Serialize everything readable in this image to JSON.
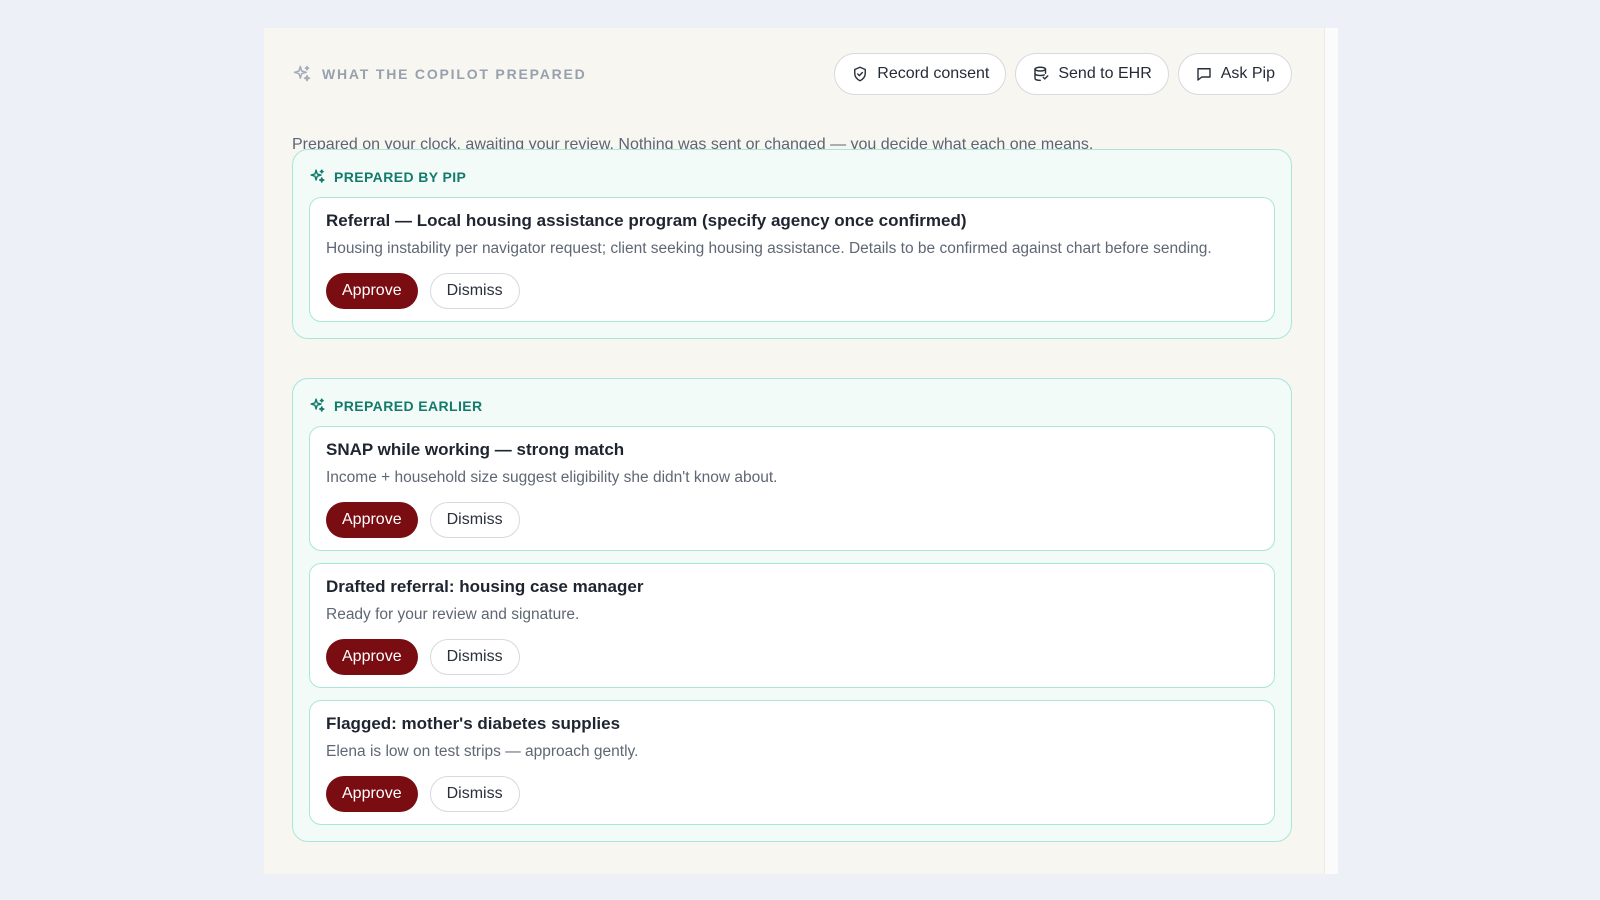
{
  "header": {
    "title": "WHAT THE COPILOT PREPARED",
    "actions": {
      "record_consent": "Record consent",
      "send_to_ehr": "Send to EHR",
      "ask_pip": "Ask Pip"
    }
  },
  "subtitle": "Prepared on your clock, awaiting your review. Nothing was sent or changed — you decide what each one means.",
  "sections": [
    {
      "label": "PREPARED BY PIP",
      "cards": [
        {
          "title": "Referral — Local housing assistance program (specify agency once confirmed)",
          "desc": "Housing instability per navigator request; client seeking housing assistance. Details to be confirmed against chart before sending.",
          "approve": "Approve",
          "dismiss": "Dismiss"
        }
      ]
    },
    {
      "label": "PREPARED EARLIER",
      "cards": [
        {
          "title": "SNAP while working — strong match",
          "desc": "Income + household size suggest eligibility she didn't know about.",
          "approve": "Approve",
          "dismiss": "Dismiss"
        },
        {
          "title": "Drafted referral: housing case manager",
          "desc": "Ready for your review and signature.",
          "approve": "Approve",
          "dismiss": "Dismiss"
        },
        {
          "title": "Flagged: mother's diabetes supplies",
          "desc": "Elena is low on test strips — approach gently.",
          "approve": "Approve",
          "dismiss": "Dismiss"
        }
      ]
    }
  ],
  "colors": {
    "accent": "#137a6c",
    "approve": "#7a0d12",
    "card_border": "#a9e6d9",
    "section_bg": "#f2fbf8"
  },
  "icons": {
    "header": "sparkle-icon",
    "record_consent": "shield-check-icon",
    "send_to_ehr": "database-icon",
    "ask_pip": "message-square-icon",
    "section": "sparkle-icon"
  }
}
